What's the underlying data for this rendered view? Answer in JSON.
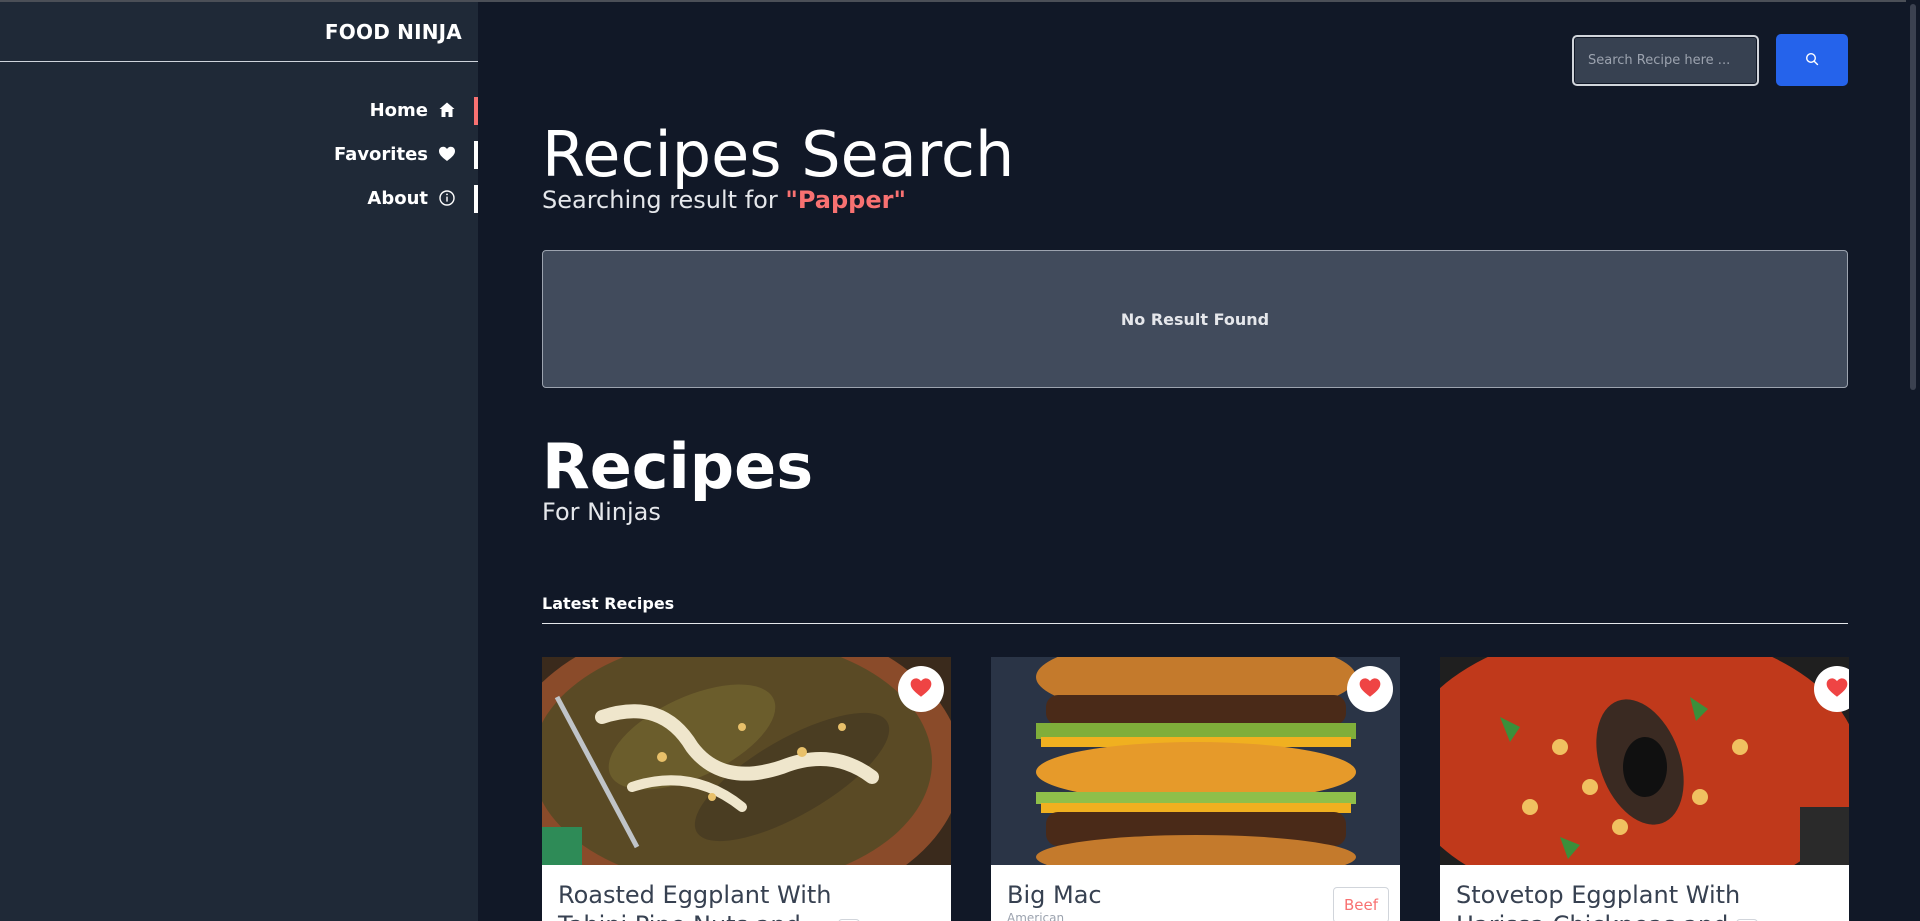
{
  "sidebar": {
    "brand": "FOOD NINJA",
    "items": [
      {
        "label": "Home",
        "icon": "home-icon",
        "active": true
      },
      {
        "label": "Favorites",
        "icon": "heart-icon",
        "active": false
      },
      {
        "label": "About",
        "icon": "info-icon",
        "active": false
      }
    ]
  },
  "search": {
    "placeholder": "Search Recipe here ...",
    "button_icon": "search-icon"
  },
  "results": {
    "heading": "Recipes Search",
    "subtitle_prefix": "Searching result for ",
    "query": "\"Papper\"",
    "empty_message": "No Result Found"
  },
  "recipes": {
    "heading": "Recipes",
    "subtitle": "For Ninjas",
    "section_label": "Latest Recipes",
    "cards": [
      {
        "title_line1": "Roasted Eggplant With",
        "title_line2": "Tahini Pine Nuts and",
        "favorite_icon": "heart-icon"
      },
      {
        "title_line1": "Big Mac",
        "subtitle": "American",
        "badge": "Beef",
        "favorite_icon": "heart-icon"
      },
      {
        "title_line1": "Stovetop Eggplant With",
        "title_line2": "Harissa Chickpeas and",
        "favorite_icon": "heart-icon"
      }
    ]
  },
  "colors": {
    "background": "#111827",
    "sidebar": "#1f2937",
    "accent": "#f87171",
    "button": "#2563eb"
  }
}
